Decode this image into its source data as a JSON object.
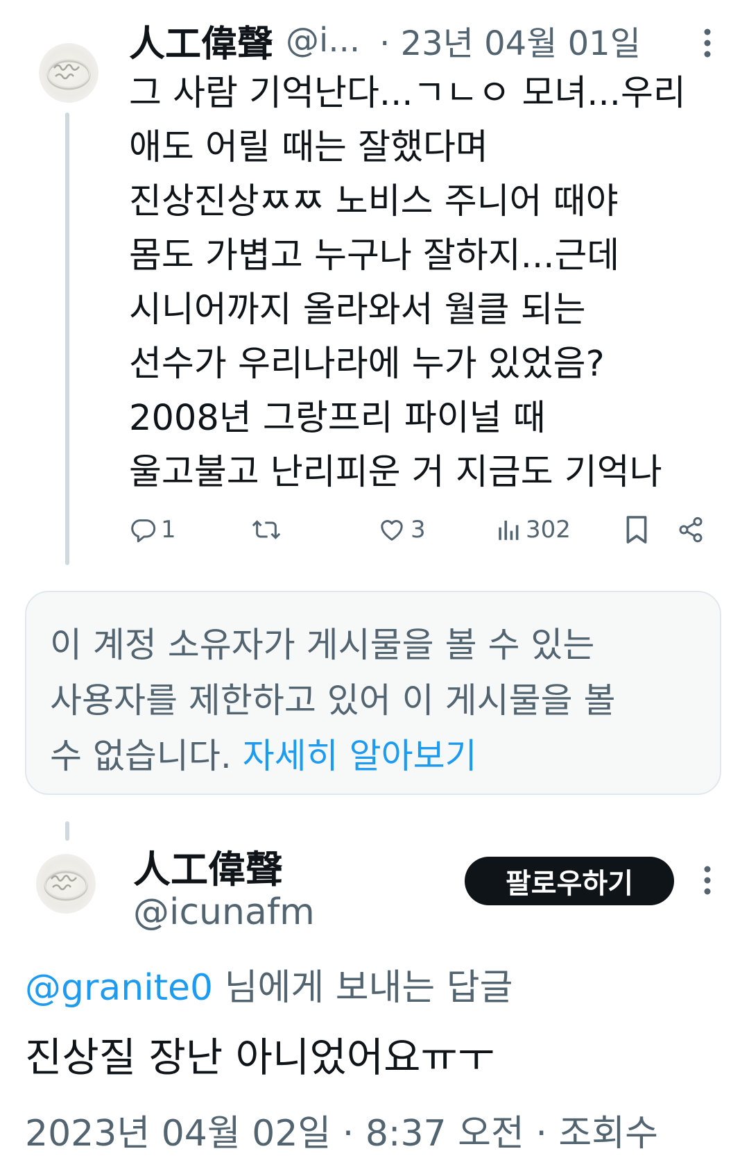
{
  "tweet1": {
    "display_name": "人工偉聲",
    "handle": "@i...",
    "date": "· 23년 04월 01일",
    "body_lines": [
      "그 사람 기억난다...ㄱㄴㅇ 모녀...우리",
      "애도 어릴 때는 잘했다며",
      "진상진상ㅉㅉ 노비스 주니어 때야",
      "몸도 가볍고 누구나 잘하지...근데",
      "시니어까지 올라와서 월클 되는",
      "선수가 우리나라에 누가 있었음?",
      "2008년 그랑프리 파이널 때",
      "울고불고 난리피운 거 지금도 기억나"
    ],
    "actions": {
      "replies": "1",
      "likes": "3",
      "views": "302"
    }
  },
  "notice": {
    "lines": [
      "이 계정 소유자가 게시물을 볼 수 있는",
      "사용자를 제한하고 있어 이 게시물을 볼"
    ],
    "last_line": "수 없습니다. ",
    "learn_more": "자세히 알아보기"
  },
  "tweet2": {
    "display_name": "人工偉聲",
    "handle": "@icunafm",
    "follow_label": "팔로우하기",
    "reply_mention": "@granite0",
    "reply_suffix": " 님에게 보내는 답글",
    "body": "진상질 장난 아니었어요ㅠㅜ",
    "meta": "2023년 04월 02일 · 8:37 오전 · 조회수"
  },
  "colors": {
    "text": "#0f1419",
    "secondary": "#536471",
    "link": "#1d9bf0",
    "thread_line": "#cfd9de",
    "notice_bg": "#f7f9f9"
  }
}
